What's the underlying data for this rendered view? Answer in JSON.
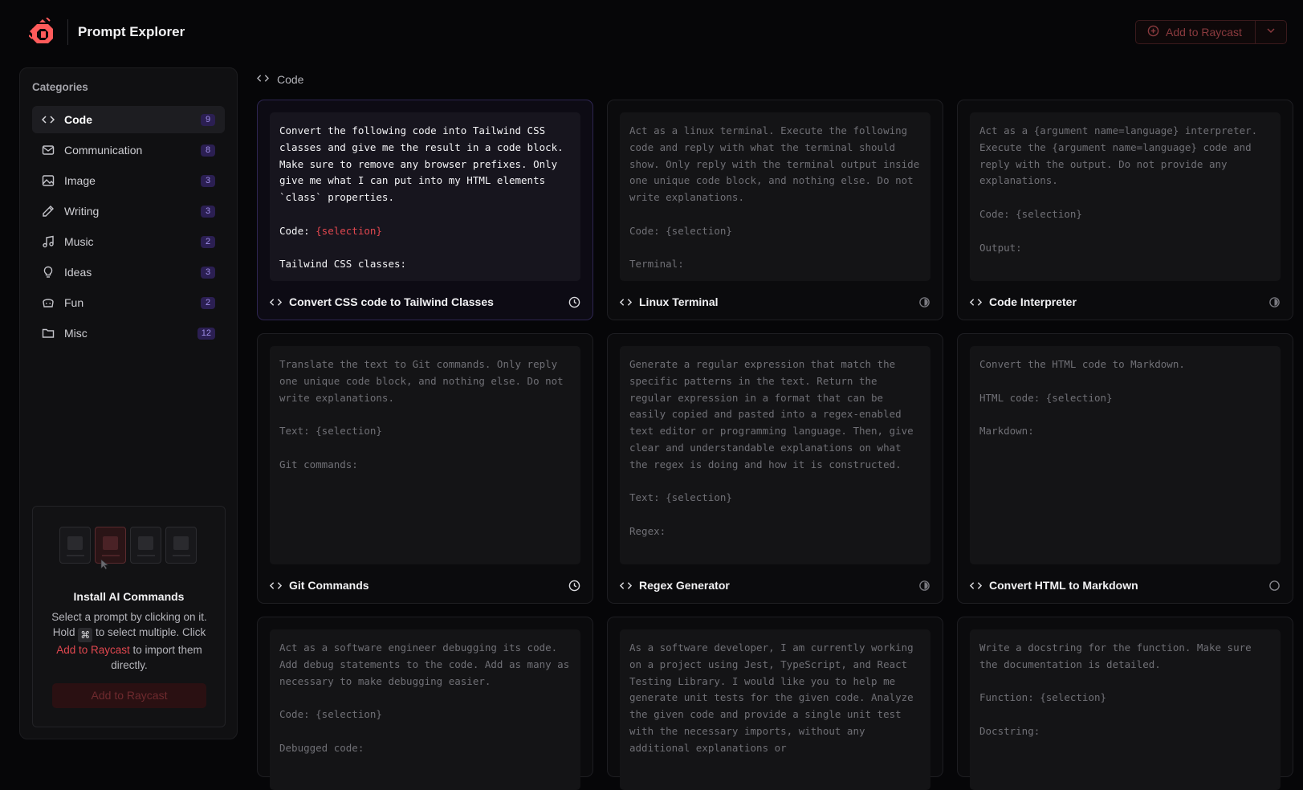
{
  "app": {
    "title": "Prompt Explorer",
    "add_button_label": "Add to Raycast"
  },
  "sidebar": {
    "heading": "Categories",
    "items": [
      {
        "label": "Code",
        "count": "9",
        "icon": "code-icon"
      },
      {
        "label": "Communication",
        "count": "8",
        "icon": "mail-icon"
      },
      {
        "label": "Image",
        "count": "3",
        "icon": "image-icon"
      },
      {
        "label": "Writing",
        "count": "3",
        "icon": "pencil-icon"
      },
      {
        "label": "Music",
        "count": "2",
        "icon": "music-icon"
      },
      {
        "label": "Ideas",
        "count": "3",
        "icon": "lightbulb-icon"
      },
      {
        "label": "Fun",
        "count": "2",
        "icon": "fun-icon"
      },
      {
        "label": "Misc",
        "count": "12",
        "icon": "folder-icon"
      }
    ],
    "active_item": "Code"
  },
  "install": {
    "title": "Install AI Commands",
    "text_before_kbd": "Select a prompt by clicking on it. Hold ",
    "kbd": "⌘",
    "text_after_kbd": " to select multiple. Click ",
    "link": "Add to Raycast",
    "text_end": " to import them directly.",
    "button_label": "Add to Raycast"
  },
  "breadcrumb": {
    "label": "Code"
  },
  "cards": [
    {
      "title": "Convert CSS code to Tailwind Classes",
      "before": "Convert the following code into Tailwind CSS classes and give me the result in a code block. Make sure to remove any browser prefixes. Only give me what I can put into my HTML elements `class` properties.\n\nCode: ",
      "highlight": "{selection}",
      "after": "\n\nTailwind CSS classes:",
      "status": "clock-icon",
      "selected": true
    },
    {
      "title": "Linux Terminal",
      "before": "Act as a linux terminal. Execute the following code and reply with what the terminal should show. Only reply with the terminal output inside one unique code block, and nothing else. Do not write explanations.\n\nCode: {selection}\n\nTerminal:",
      "highlight": "",
      "after": "",
      "status": "half-circle-icon",
      "selected": false
    },
    {
      "title": "Code Interpreter",
      "before": "Act as a {argument name=language} interpreter. Execute the {argument name=language} code and reply with the output. Do not provide any explanations.\n\nCode: {selection}\n\nOutput:",
      "highlight": "",
      "after": "",
      "status": "half-circle-icon",
      "selected": false
    },
    {
      "title": "Git Commands",
      "before": "Translate the text to Git commands. Only reply one unique code block, and nothing else. Do not write explanations.\n\nText: {selection}\n\nGit commands:",
      "highlight": "",
      "after": "",
      "status": "clock-icon",
      "selected": false
    },
    {
      "title": "Regex Generator",
      "before": "Generate a regular expression that match the specific patterns in the text. Return the regular expression in a format that can be easily copied and pasted into a regex-enabled text editor or programming language. Then, give clear and understandable explanations on what the regex is doing and how it is constructed.\n\nText: {selection}\n\nRegex:",
      "highlight": "",
      "after": "",
      "status": "half-circle-icon",
      "selected": false
    },
    {
      "title": "Convert HTML to Markdown",
      "before": "Convert the HTML code to Markdown.\n\nHTML code: {selection}\n\nMarkdown:",
      "highlight": "",
      "after": "",
      "status": "empty-circle-icon",
      "selected": false
    },
    {
      "title": "",
      "before": "Act as a software engineer debugging its code. Add debug statements to the code. Add as many as necessary to make debugging easier.\n\nCode: {selection}\n\nDebugged code:",
      "highlight": "",
      "after": "",
      "status": "",
      "selected": false
    },
    {
      "title": "",
      "before": "As a software developer, I am currently working on a project using Jest, TypeScript, and React Testing Library. I would like you to help me generate unit tests for the given code. Analyze the given code and provide a single unit test with the necessary imports, without any additional explanations or",
      "highlight": "",
      "after": "",
      "status": "",
      "selected": false
    },
    {
      "title": "",
      "before": "Write a docstring for the function. Make sure the documentation is detailed.\n\nFunction: {selection}\n\nDocstring:",
      "highlight": "",
      "after": "",
      "status": "",
      "selected": false
    }
  ],
  "colors": {
    "accent": "#e0474f",
    "badge_bg": "#2b1f52",
    "badge_text": "#9f8ee8",
    "background": "#060608"
  }
}
